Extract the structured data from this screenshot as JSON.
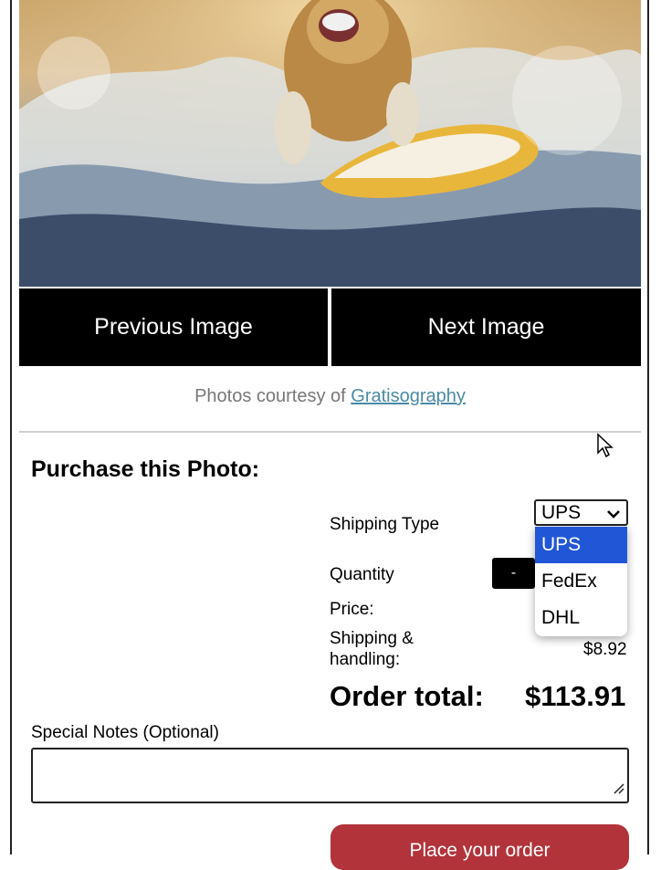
{
  "gallery": {
    "previous_label": "Previous Image",
    "next_label": "Next Image",
    "credit_prefix": "Photos courtesy of ",
    "credit_link": "Gratisography"
  },
  "purchase": {
    "title": "Purchase this Photo:",
    "shipping_type_label": "Shipping Type",
    "shipping_selected": "UPS",
    "shipping_options": [
      "UPS",
      "FedEx",
      "DHL"
    ],
    "quantity_label": "Quantity",
    "decrement_label": "-",
    "price_label": "Price:",
    "shipping_handling_line1": "Shipping &",
    "shipping_handling_line2": "handling:",
    "shipping_handling_value": "$8.92",
    "order_total_label": "Order total:",
    "order_total_value": "$113.91",
    "notes_label": "Special Notes (Optional)",
    "notes_value": "",
    "place_order_label": "Place your order"
  },
  "colors": {
    "nav_button_bg": "#000000",
    "link": "#4a8ba6",
    "selected_option": "#2156d6",
    "order_button": "#b3333b"
  },
  "photo": {
    "subject": "dog surfing on a yellow surfboard"
  }
}
